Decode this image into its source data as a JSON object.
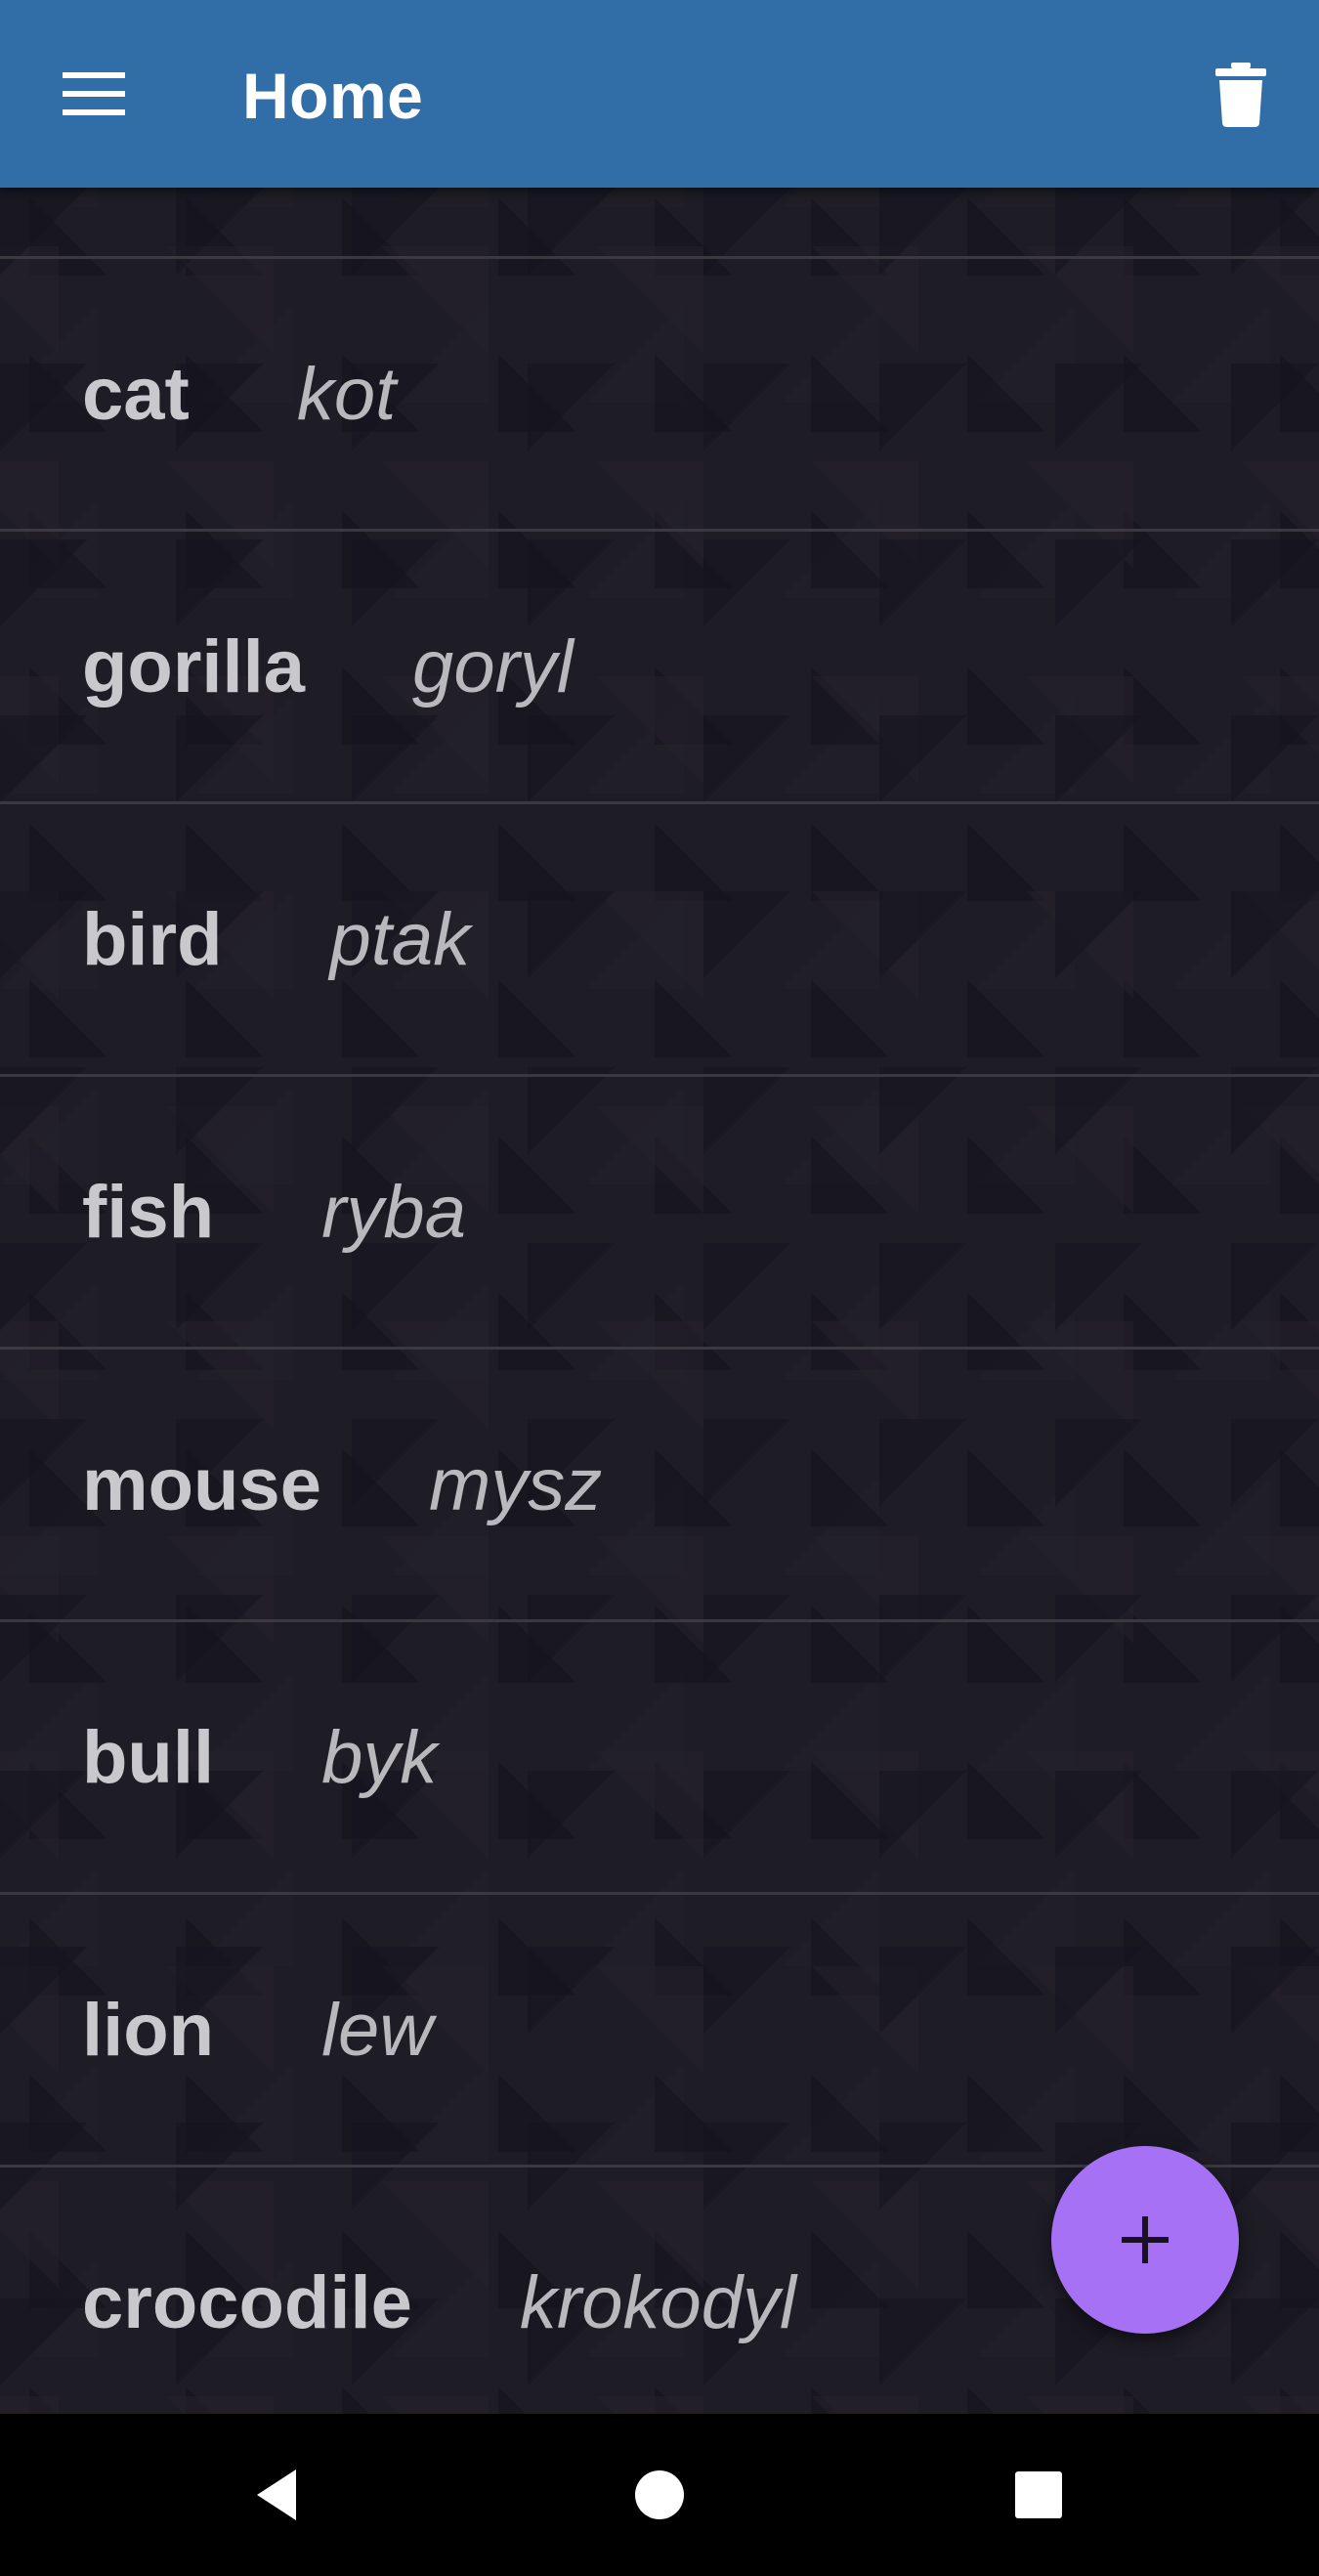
{
  "app_bar": {
    "title": "Home",
    "background": "#316ea7",
    "menu_icon": "hamburger-menu-icon",
    "delete_icon": "trash-icon"
  },
  "words": [
    {
      "english": "cat",
      "polish": "kot"
    },
    {
      "english": "gorilla",
      "polish": "goryl"
    },
    {
      "english": "bird",
      "polish": "ptak"
    },
    {
      "english": "fish",
      "polish": "ryba"
    },
    {
      "english": "mouse",
      "polish": "mysz"
    },
    {
      "english": "bull",
      "polish": "byk"
    },
    {
      "english": "lion",
      "polish": "lew"
    },
    {
      "english": "crocodile",
      "polish": "krokodyl"
    }
  ],
  "fab": {
    "icon": "plus-icon",
    "color": "#a771f6"
  },
  "nav_bar": {
    "back_icon": "back-triangle-icon",
    "home_icon": "home-circle-icon",
    "recents_icon": "recents-square-icon"
  }
}
